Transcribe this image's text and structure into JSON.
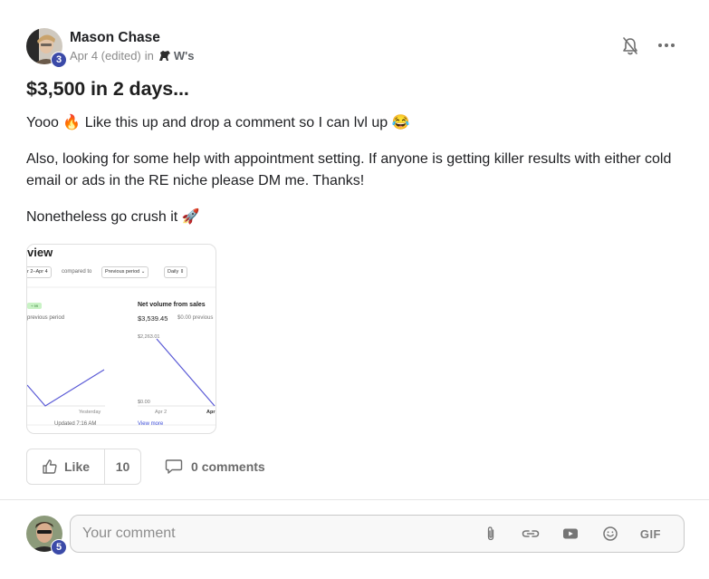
{
  "post": {
    "author": {
      "name": "Mason Chase",
      "level": "3",
      "date": "Apr 4 (edited)",
      "in_text": "in",
      "group": "W's"
    },
    "title": "$3,500 in 2 days...",
    "body": [
      "Yooo 🔥 Like this up and drop a comment so I can lvl up 😂",
      "Also, looking for some help with appointment setting. If anyone is getting killer results with either cold email or ads in the RE niche please DM me. Thanks!",
      "Nonetheless go crush it 🚀"
    ],
    "attachment": {
      "title": "view",
      "date_range": "r 2–Apr 4",
      "compared_to": "compared to",
      "period": "Previous period",
      "interval": "Daily",
      "badge": "+ 99",
      "previous_period": "previous period",
      "left_xlabel": "Yesterday",
      "updated": "Updated 7:16 AM",
      "metric_title": "Net volume from sales",
      "metric_value": "$3,539.45",
      "metric_previous": "$0.00 previous",
      "y_top": "$2,263.01",
      "y_bottom": "$0.00",
      "x_start": "Apr 2",
      "x_end": "Apr",
      "view_more": "View more"
    },
    "actions": {
      "like_label": "Like",
      "like_count": "10",
      "comments_label": "0 comments"
    }
  },
  "comment": {
    "placeholder": "Your comment",
    "user_level": "5",
    "gif_label": "GIF"
  },
  "colors": {
    "level_badge": "#3b4aa8",
    "chart_line": "#5a5ad6"
  }
}
